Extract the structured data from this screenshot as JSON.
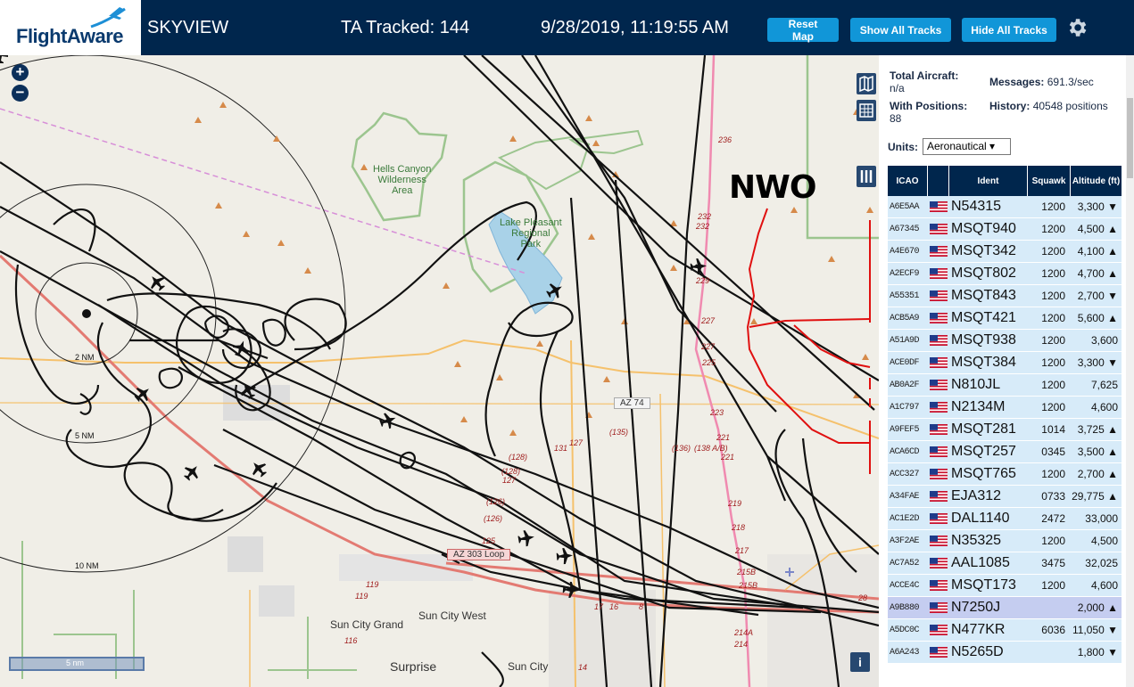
{
  "header": {
    "logo_text": "FlightAware",
    "app_title": "SKYVIEW",
    "tracked": "TA Tracked: 144",
    "datetime": "9/28/2019, 11:19:55 AM",
    "reset_label": "Reset Map",
    "show_all_label": "Show All Tracks",
    "hide_all_label": "Hide All Tracks",
    "settings_icon": "gear-icon",
    "colors": {
      "bar": "#00264d",
      "button": "#1196d8"
    }
  },
  "map": {
    "labels": {
      "hells_canyon": "Hells Canyon\nWilderness\nArea",
      "lake_pleasant": "Lake Pleasant\nRegional\nPark",
      "az74": "AZ 74",
      "az303": "AZ 303 Loop",
      "sun_city_grand": "Sun City Grand",
      "sun_city_west": "Sun City West",
      "surprise": "Surprise",
      "sun_city": "Sun City",
      "ring_2": "2 NM",
      "ring_5": "5 NM",
      "ring_10": "10 NM",
      "annotation": "NWO",
      "scale": "5 nm"
    },
    "exits": [
      "236",
      "232",
      "232",
      "229",
      "227",
      "227",
      "225",
      "223",
      "221",
      "221",
      "219",
      "218",
      "217",
      "215B",
      "215B",
      "214A",
      "214",
      "(135)",
      "(136)",
      "(138 A/B)",
      "131",
      "127",
      "(128)",
      "(128)",
      "127",
      "(126)",
      "(126)",
      "125",
      "119",
      "119",
      "116",
      "14",
      "17",
      "16",
      "8",
      "28"
    ],
    "zoom_in": "+",
    "zoom_out": "−",
    "info": "i"
  },
  "panel": {
    "total_aircraft_label": "Total Aircraft:",
    "total_aircraft_value": "n/a",
    "messages_label": "Messages:",
    "messages_value": "691.3/sec",
    "with_positions_label": "With Positions:",
    "with_positions_value": "88",
    "history_label": "History:",
    "history_value": "40548 positions",
    "units_label": "Units:",
    "units_value": "Aeronautical ▾",
    "columns": {
      "icao": "ICAO",
      "ident": "Ident",
      "squawk": "Squawk",
      "altitude": "Altitude (ft)"
    },
    "rows": [
      {
        "icao": "A6E5AA",
        "ident": "N54315",
        "squawk": "1200",
        "alt": "3,300 ▼"
      },
      {
        "icao": "A67345",
        "ident": "MSQT940",
        "squawk": "1200",
        "alt": "4,500 ▲"
      },
      {
        "icao": "A4E670",
        "ident": "MSQT342",
        "squawk": "1200",
        "alt": "4,100 ▲"
      },
      {
        "icao": "A2ECF9",
        "ident": "MSQT802",
        "squawk": "1200",
        "alt": "4,700 ▲"
      },
      {
        "icao": "A55351",
        "ident": "MSQT843",
        "squawk": "1200",
        "alt": "2,700 ▼"
      },
      {
        "icao": "ACB5A9",
        "ident": "MSQT421",
        "squawk": "1200",
        "alt": "5,600 ▲"
      },
      {
        "icao": "A51A9D",
        "ident": "MSQT938",
        "squawk": "1200",
        "alt": "3,600"
      },
      {
        "icao": "ACE0DF",
        "ident": "MSQT384",
        "squawk": "1200",
        "alt": "3,300 ▼"
      },
      {
        "icao": "AB0A2F",
        "ident": "N810JL",
        "squawk": "1200",
        "alt": "7,625"
      },
      {
        "icao": "A1C797",
        "ident": "N2134M",
        "squawk": "1200",
        "alt": "4,600"
      },
      {
        "icao": "A9FEF5",
        "ident": "MSQT281",
        "squawk": "1014",
        "alt": "3,725 ▲"
      },
      {
        "icao": "ACA6CD",
        "ident": "MSQT257",
        "squawk": "0345",
        "alt": "3,500 ▲"
      },
      {
        "icao": "ACC327",
        "ident": "MSQT765",
        "squawk": "1200",
        "alt": "2,700 ▲"
      },
      {
        "icao": "A34FAE",
        "ident": "EJA312",
        "squawk": "0733",
        "alt": "29,775 ▲"
      },
      {
        "icao": "AC1E2D",
        "ident": "DAL1140",
        "squawk": "2472",
        "alt": "33,000"
      },
      {
        "icao": "A3F2AE",
        "ident": "N35325",
        "squawk": "1200",
        "alt": "4,500"
      },
      {
        "icao": "AC7A52",
        "ident": "AAL1085",
        "squawk": "3475",
        "alt": "32,025"
      },
      {
        "icao": "ACCE4C",
        "ident": "MSQT173",
        "squawk": "1200",
        "alt": "4,600"
      },
      {
        "icao": "A9B880",
        "ident": "N7250J",
        "squawk": "",
        "alt": "2,000 ▲",
        "selected": true
      },
      {
        "icao": "A5DC0C",
        "ident": "N477KR",
        "squawk": "6036",
        "alt": "11,050 ▼"
      },
      {
        "icao": "A6A243",
        "ident": "N5265D",
        "squawk": "",
        "alt": "1,800 ▼"
      }
    ],
    "colors": {
      "table_header": "#00264d",
      "row": "#d7ebf9",
      "selected_row": "#c5cdf0"
    }
  }
}
